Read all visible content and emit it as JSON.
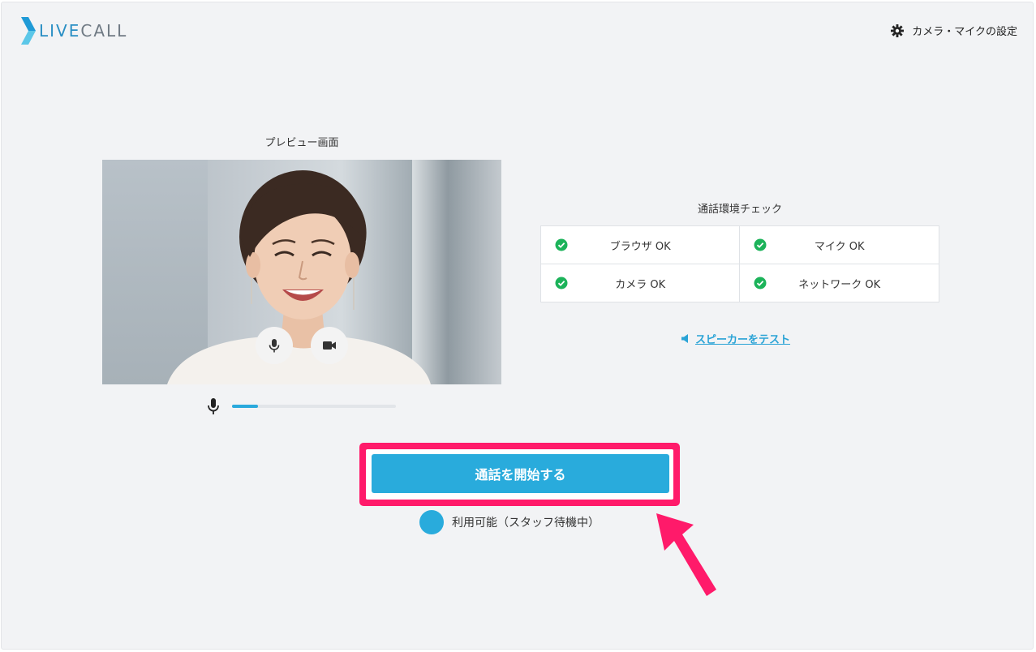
{
  "header": {
    "logo_live": "LIVE",
    "logo_call": "CALL",
    "settings_label": "カメラ・マイクの設定"
  },
  "preview": {
    "title": "プレビュー画面",
    "mic_level": 0.16
  },
  "env_check": {
    "title": "通話環境チェック",
    "items": [
      {
        "label": "ブラウザ OK"
      },
      {
        "label": "マイク OK"
      },
      {
        "label": "カメラ OK"
      },
      {
        "label": "ネットワーク OK"
      }
    ]
  },
  "speaker_test_label": "スピーカーをテスト",
  "start_call_label": "通話を開始する",
  "status_label": "利用可能（スタッフ待機中）",
  "colors": {
    "accent": "#29abdc",
    "check_green": "#1cb35a",
    "highlight": "#ff1a6a"
  }
}
